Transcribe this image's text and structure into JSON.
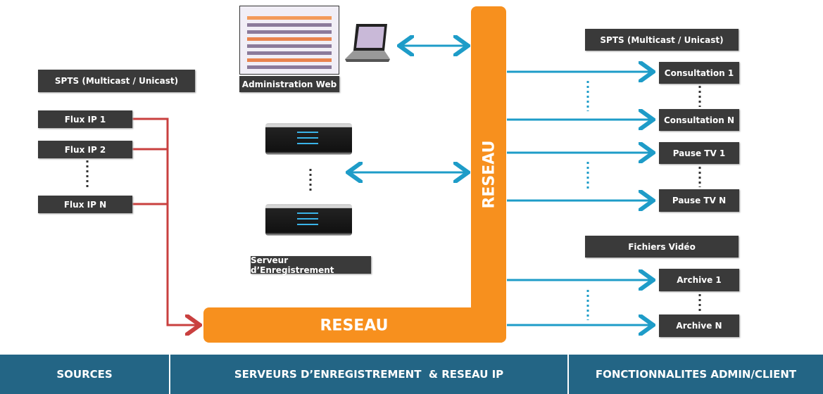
{
  "left": {
    "stream_type": "SPTS (Multicast / Unicast)",
    "flows": [
      "Flux IP 1",
      "Flux IP 2",
      "Flux IP N"
    ]
  },
  "center": {
    "admin_label": "Administration Web",
    "server_label": "Serveur d’Enregistrement",
    "network_vertical": "RESEAU",
    "network_horizontal": "RESEAU"
  },
  "right": {
    "stream_type": "SPTS (Multicast / Unicast)",
    "consultation": [
      "Consultation 1",
      "Consultation N"
    ],
    "pause": [
      "Pause TV 1",
      "Pause TV N"
    ],
    "files_label": "Fichiers Vidéo",
    "archive": [
      "Archive 1",
      "Archive N"
    ]
  },
  "footer": {
    "sources": "SOURCES",
    "servers": "SERVEURS D’ENREGISTREMENT  & RESEAU IP",
    "functions": "FONCTIONNALITES ADMIN/CLIENT"
  },
  "colors": {
    "network": "#f7901e",
    "client_arrows": "#1e9cc8",
    "source_lines": "#c9403f",
    "footer": "#236585",
    "labels": "#3a3a3a"
  }
}
